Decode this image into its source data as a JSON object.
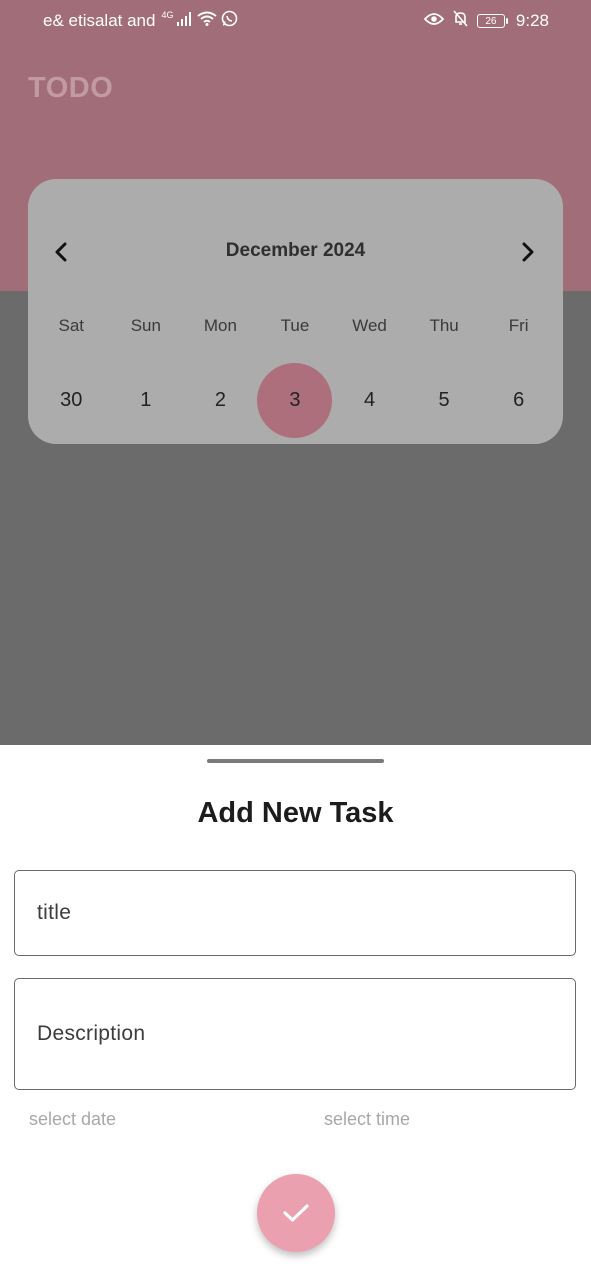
{
  "status_bar": {
    "carrier": "e& etisalat and",
    "network": "4G",
    "battery": "26",
    "time": "9:28"
  },
  "app": {
    "title": "TODO",
    "header_color": "#a16d78"
  },
  "calendar": {
    "month_label": "December 2024",
    "weekdays": [
      "Sat",
      "Sun",
      "Mon",
      "Tue",
      "Wed",
      "Thu",
      "Fri"
    ],
    "days": [
      "30",
      "1",
      "2",
      "3",
      "4",
      "5",
      "6"
    ],
    "selected_day": "3"
  },
  "sheet": {
    "title": "Add New Task",
    "title_field_placeholder": "title",
    "description_field_placeholder": "Description",
    "select_date_label": "select date",
    "select_time_label": "select time",
    "confirm_icon": "check-icon",
    "accent_color": "#eaa0ae"
  }
}
